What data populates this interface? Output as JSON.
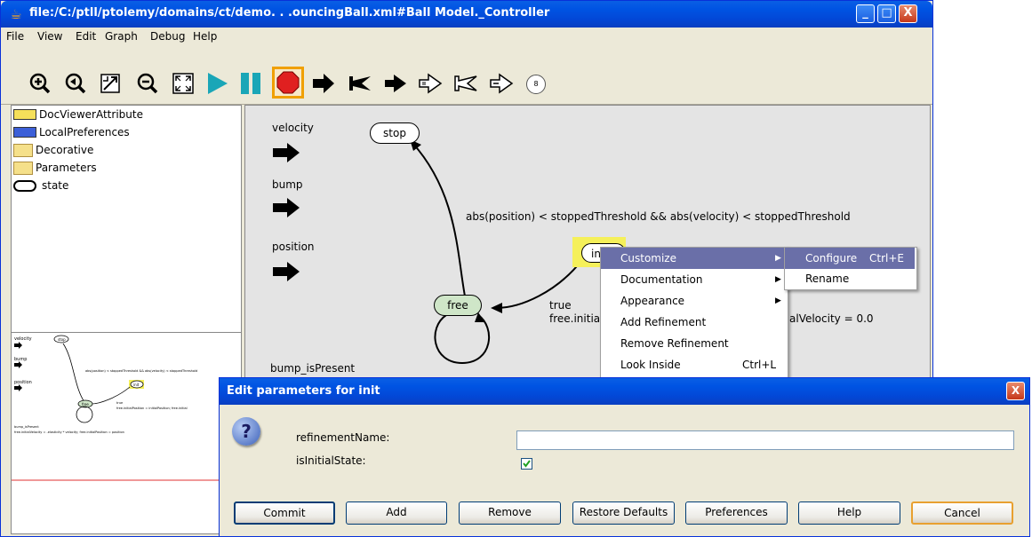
{
  "window": {
    "title": "file:/C:/ptll/ptolemy/domains/ct/demo. . .ouncingBall.xml#Ball Model._Controller",
    "minimize_glyph": "_",
    "maximize_glyph": "□",
    "close_glyph": "X"
  },
  "menubar": [
    "File",
    "View",
    "Edit",
    "Graph",
    "Debug",
    "Help"
  ],
  "toolbar": {
    "icons": [
      "zoom-in-icon",
      "zoom-reset-icon",
      "zoom-fit-icon",
      "zoom-out-icon",
      "full-screen-icon",
      "run-icon",
      "pause-icon",
      "stop-icon",
      "step-arrow-icon",
      "flag-arrow-icon",
      "arrow-icon",
      "outline-arrow-icon",
      "outline-flag-icon",
      "outline-double-arrow-icon",
      "count-badge-icon"
    ],
    "badge_value": "8",
    "colors": {
      "run": "#1aa6b7",
      "stop": "#e02020",
      "stop_border": "#f0a000"
    }
  },
  "library": {
    "items": [
      {
        "label": "DocViewerAttribute",
        "icon": "doc-viewer-attribute-icon"
      },
      {
        "label": "LocalPreferences",
        "icon": "local-preferences-icon"
      },
      {
        "label": "Decorative",
        "icon": "folder-icon"
      },
      {
        "label": "Parameters",
        "icon": "folder-icon"
      },
      {
        "label": "state",
        "icon": "state-ellipse-icon"
      }
    ]
  },
  "overview": {
    "labels": {
      "velocity": "velocity",
      "bump": "bump",
      "position": "position",
      "stop": "stop",
      "init": "init",
      "free": "free",
      "guard": "abs(position) < stoppedThreshold && abs(velocity) < stoppedThreshold",
      "true": "true",
      "action": "free.initialPosition = initialPosition; free.initial",
      "bump_isPresent": "bump_isPresent",
      "bump_action": "free.initialVelocity = -elasticity * velocity; free.initialPosition = position"
    }
  },
  "canvas": {
    "ports": [
      "velocity",
      "bump",
      "position"
    ],
    "states": {
      "stop": "stop",
      "free": "free",
      "init": "init"
    },
    "guard_label": "abs(position) < stoppedThreshold && abs(velocity) < stoppedThreshold",
    "transition_true": "true",
    "transition_action": "free.initia",
    "velocity_action": "alVelocity = 0.0",
    "bump_label": "bump_isPresent",
    "colors": {
      "free_fill": "#cfe6c8",
      "init_highlight": "#f5f05a",
      "background": "#e4e4e4"
    }
  },
  "context_menu": {
    "items": [
      {
        "label": "Customize",
        "submenu": true,
        "selected": true
      },
      {
        "label": "Documentation",
        "submenu": true
      },
      {
        "label": "Appearance",
        "submenu": true
      },
      {
        "label": "Add Refinement"
      },
      {
        "label": "Remove Refinement"
      },
      {
        "label": "Look Inside",
        "shortcut": "Ctrl+L"
      }
    ],
    "submenu": [
      {
        "label": "Configure",
        "shortcut": "Ctrl+E",
        "selected": true
      },
      {
        "label": "Rename"
      }
    ]
  },
  "dialog": {
    "title": "Edit parameters for init",
    "close_glyph": "X",
    "fields": {
      "refinementName_label": "refinementName:",
      "refinementName_value": "",
      "isInitialState_label": "isInitialState:",
      "isInitialState_checked": true
    },
    "buttons": [
      "Commit",
      "Add",
      "Remove",
      "Restore Defaults",
      "Preferences",
      "Help",
      "Cancel"
    ]
  }
}
